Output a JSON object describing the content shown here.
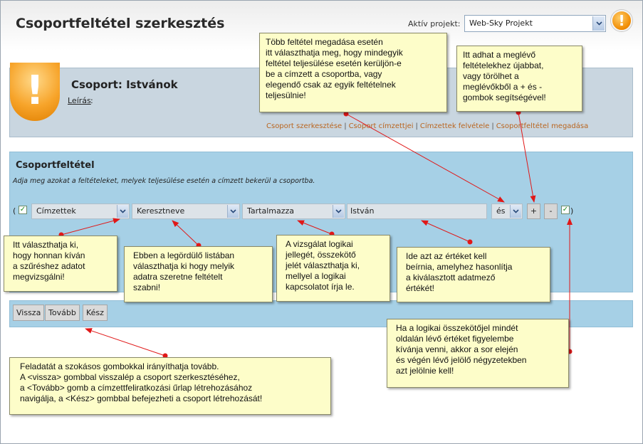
{
  "header": {
    "title": "Csoportfeltétel szerkesztés",
    "project_label": "Aktív projekt:",
    "project_value": "Web-Sky Projekt"
  },
  "group": {
    "title": "Csoport: Istvánok",
    "description_label": "Leírás",
    "description_colon": ":",
    "links": [
      "Csoport szerkesztése",
      "Csoport címzettjei",
      "Címzettek felvétele",
      "Csoportfeltétel megadása"
    ]
  },
  "condition": {
    "title": "Csoportfeltétel",
    "subtitle": "Adja meg azokat a feltételeket, melyek teljesülése esetén a címzett bekerül a csoportba.",
    "open_paren": "(",
    "close_paren": ")",
    "source": "Címzettek",
    "field": "Keresztneve",
    "operator": "Tartalmazza",
    "value": "István",
    "connector": "és",
    "add_label": "+",
    "remove_label": "-",
    "check_mark": "✓",
    "left_checked": true,
    "right_checked": true
  },
  "buttons": {
    "back": "Vissza",
    "next": "Tovább",
    "done": "Kész"
  },
  "notes": {
    "top_middle": [
      "Több feltétel megadása esetén",
      "itt választhatja meg, hogy mindegyik",
      "feltétel teljesülése esetén kerüljön-e",
      "be a címzett a csoportba, vagy",
      "elegendő csak az egyik feltételnek",
      "teljesülnie!"
    ],
    "top_right": [
      "Itt adhat a meglévő",
      "feltételekhez újabbat,",
      "vagy törölhet a",
      "meglévőkből a + és -",
      "gombok segítségével!"
    ],
    "source": [
      "Itt választhatja ki,",
      "hogy honnan kíván",
      "a szűréshez adatot",
      "megvizsgálni!"
    ],
    "field": [
      "Ebben a legördülő listában",
      "választhatja ki hogy melyik",
      "adatra szeretne feltételt",
      "szabni!"
    ],
    "operator": [
      "A vizsgálat logikai",
      "jellegét, összekötő",
      "jelét választhatja ki,",
      "mellyel a logikai",
      "kapcsolatot írja le."
    ],
    "value": [
      "Ide azt az értéket kell",
      "beírnia, amelyhez hasonlítja",
      "a kiválasztott adatmező",
      "értékét!"
    ],
    "connector": [
      "Ha a logikai összekötőjel mindét",
      "oldalán lévő értéket figyelembe",
      "kívánja venni, akkor a sor elején",
      "és végén lévő jelölő négyzetekben",
      "azt jelölnie kell!"
    ],
    "buttons": [
      "Feladatát a szokásos gombokkal irányíthatja tovább.",
      "A <vissza> gombbal visszalép a csoport szerkesztéséhez,",
      "a <Tovább> gomb a címzettfeliratkozási űrlap létrehozásához",
      "navigálja, a <Kész> gombbal befejezheti a csoport létrehozását!"
    ]
  },
  "colors": {
    "accent": "#b9651f",
    "panel": "#a6d0e6",
    "note": "#fdfdc9",
    "arrow": "#e01818"
  },
  "icons": {
    "warning": "warning-icon",
    "dropdown": "chevron-down-icon",
    "checkbox": "checkbox-checked-icon"
  }
}
